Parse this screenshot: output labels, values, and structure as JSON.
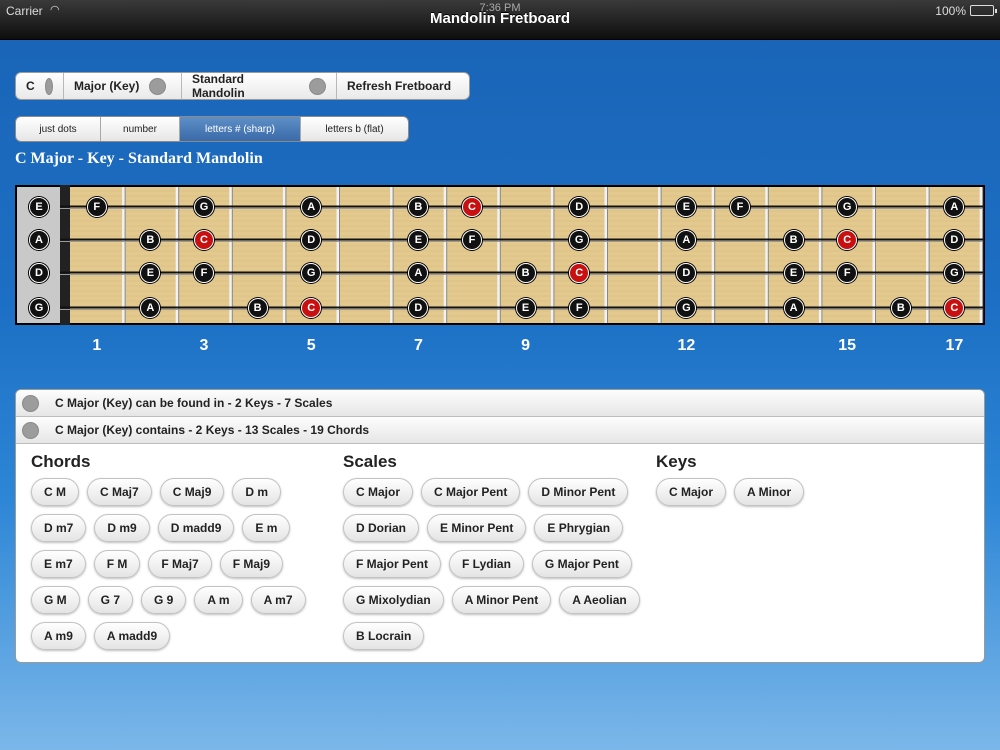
{
  "status": {
    "carrier": "Carrier",
    "time": "7:36 PM",
    "battery": "100%"
  },
  "nav": {
    "title": "Mandolin Fretboard"
  },
  "options": [
    {
      "label": "C",
      "has_dot": true
    },
    {
      "label": "Major (Key)",
      "has_dot": true
    },
    {
      "label": "Standard Mandolin",
      "has_dot": true
    },
    {
      "label": "Refresh Fretboard",
      "has_dot": false
    }
  ],
  "modes": [
    {
      "label": "just dots",
      "active": false
    },
    {
      "label": "number",
      "active": false
    },
    {
      "label": "letters # (sharp)",
      "active": true
    },
    {
      "label": "letters b (flat)",
      "active": false
    }
  ],
  "heading": "C Major - Key - Standard Mandolin",
  "fretboard": {
    "strings": [
      {
        "open": "E",
        "notes": [
          [
            1,
            "F"
          ],
          [
            3,
            "G"
          ],
          [
            5,
            "A"
          ],
          [
            7,
            "B"
          ],
          [
            8,
            "C"
          ],
          [
            10,
            "D"
          ],
          [
            12,
            "E"
          ],
          [
            13,
            "F"
          ],
          [
            15,
            "G"
          ],
          [
            17,
            "A"
          ]
        ]
      },
      {
        "open": "A",
        "notes": [
          [
            2,
            "B"
          ],
          [
            3,
            "C"
          ],
          [
            5,
            "D"
          ],
          [
            7,
            "E"
          ],
          [
            8,
            "F"
          ],
          [
            10,
            "G"
          ],
          [
            12,
            "A"
          ],
          [
            14,
            "B"
          ],
          [
            15,
            "C"
          ],
          [
            17,
            "D"
          ]
        ]
      },
      {
        "open": "D",
        "notes": [
          [
            2,
            "E"
          ],
          [
            3,
            "F"
          ],
          [
            5,
            "G"
          ],
          [
            7,
            "A"
          ],
          [
            9,
            "B"
          ],
          [
            10,
            "C"
          ],
          [
            12,
            "D"
          ],
          [
            14,
            "E"
          ],
          [
            15,
            "F"
          ],
          [
            17,
            "G"
          ]
        ]
      },
      {
        "open": "G",
        "notes": [
          [
            2,
            "A"
          ],
          [
            4,
            "B"
          ],
          [
            5,
            "C"
          ],
          [
            7,
            "D"
          ],
          [
            9,
            "E"
          ],
          [
            10,
            "F"
          ],
          [
            12,
            "G"
          ],
          [
            14,
            "A"
          ],
          [
            16,
            "B"
          ],
          [
            17,
            "C"
          ]
        ]
      }
    ],
    "root_note": "C",
    "fret_numbers": [
      1,
      3,
      5,
      7,
      9,
      12,
      15,
      17
    ],
    "colors": {
      "root": "#c81010",
      "note": "#111111",
      "wood": "#e3c98e"
    }
  },
  "info": {
    "found_in": "C Major (Key) can be found in - 2 Keys - 7 Scales",
    "contains": "C Major (Key) contains - 2 Keys - 13 Scales - 19 Chords"
  },
  "chords": {
    "title": "Chords",
    "items": [
      "C M",
      "C Maj7",
      "C Maj9",
      "D m",
      "D m7",
      "D m9",
      "D madd9",
      "E m",
      "E m7",
      "F M",
      "F Maj7",
      "F Maj9",
      "G M",
      "G 7",
      "G 9",
      "A m",
      "A m7",
      "A m9",
      "A madd9"
    ]
  },
  "scales": {
    "title": "Scales",
    "items": [
      "C Major",
      "C Major Pent",
      "D Minor Pent",
      "D Dorian",
      "E Minor Pent",
      "E Phrygian",
      "F Major Pent",
      "F Lydian",
      "G Major Pent",
      "G Mixolydian",
      "A Minor Pent",
      "A Aeolian",
      "B Locrain"
    ]
  },
  "keys": {
    "title": "Keys",
    "items": [
      "C Major",
      "A Minor"
    ]
  }
}
